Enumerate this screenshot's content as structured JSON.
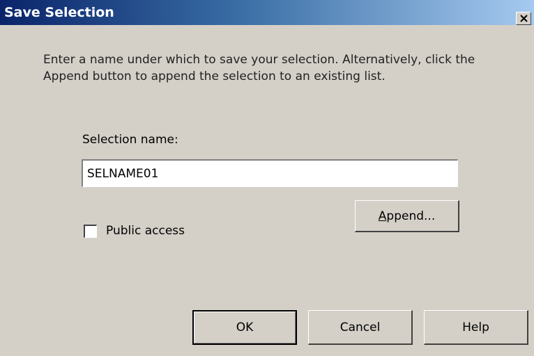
{
  "window": {
    "title": "Save Selection",
    "close_icon": "close-x-icon",
    "colors": {
      "titlebar_start": "#0a246a",
      "titlebar_end": "#a6caf0",
      "face": "#d4d0c8"
    }
  },
  "instructions": "Enter a name under which to save your selection. Alternatively, click the Append button to append the selection to an existing list.",
  "selection_name": {
    "label": "Selection name:",
    "value": "SELNAME01"
  },
  "append_button": {
    "label_pre": "",
    "label_mnemonic": "A",
    "label_post": "ppend..."
  },
  "public_access": {
    "label": "Public access",
    "checked": false
  },
  "buttons": {
    "ok": "OK",
    "cancel": "Cancel",
    "help": "Help"
  }
}
